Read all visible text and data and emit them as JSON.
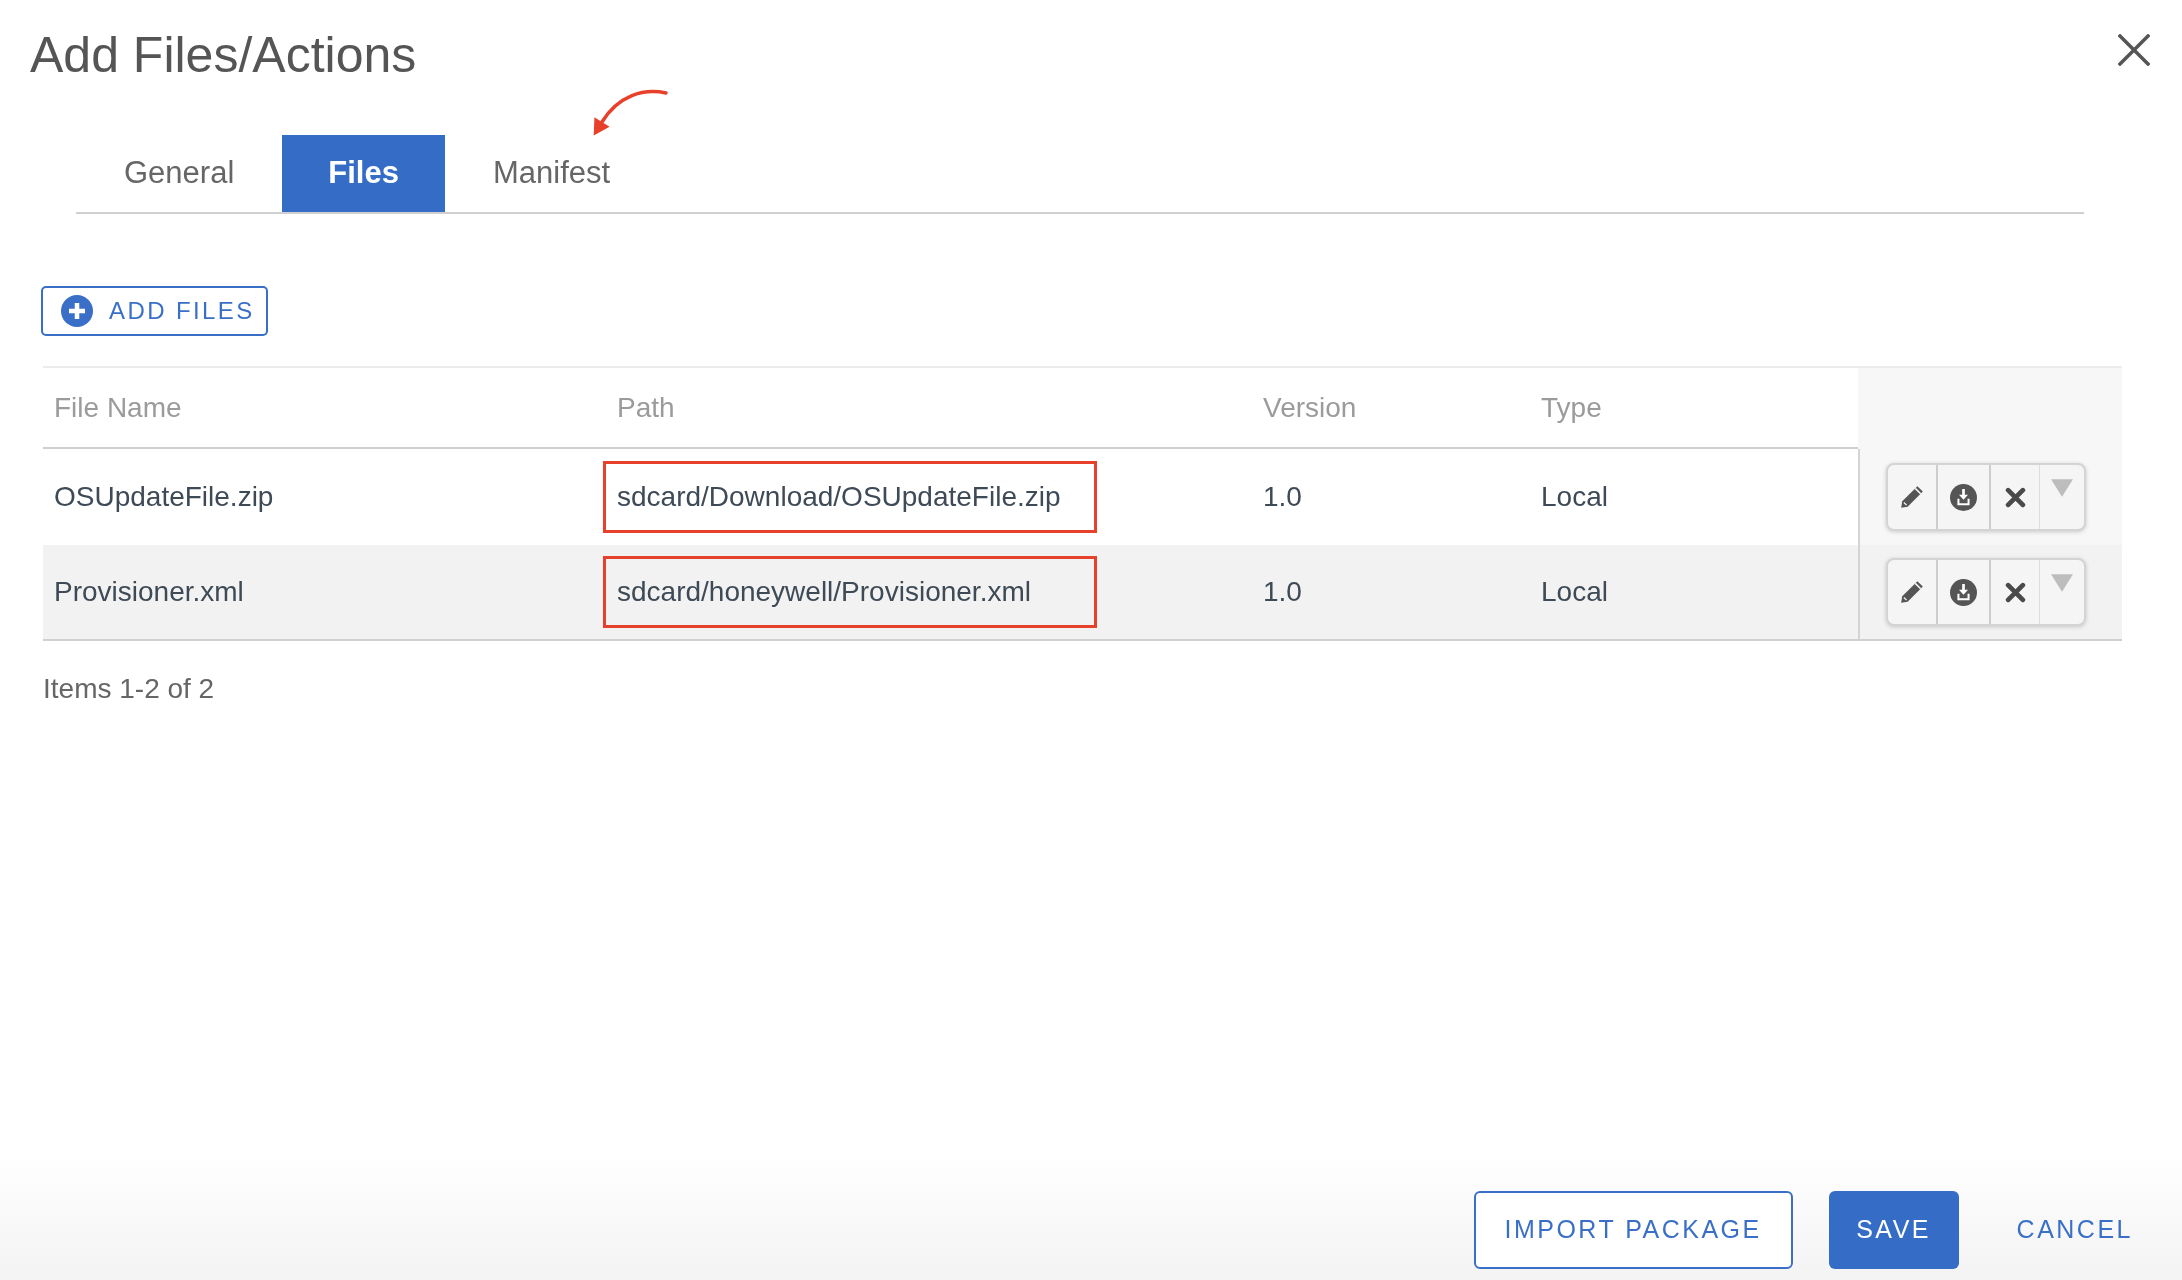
{
  "dialog": {
    "title": "Add Files/Actions"
  },
  "tabs": [
    {
      "label": "General",
      "selected": false
    },
    {
      "label": "Files",
      "selected": true
    },
    {
      "label": "Manifest",
      "selected": false
    }
  ],
  "add_files_button": {
    "label": "ADD FILES"
  },
  "table": {
    "columns": [
      "File Name",
      "Path",
      "Version",
      "Type"
    ],
    "rows": [
      {
        "file_name": "OSUpdateFile.zip",
        "path": "sdcard/Download/OSUpdateFile.zip",
        "version": "1.0",
        "type": "Local",
        "path_highlighted": true
      },
      {
        "file_name": "Provisioner.xml",
        "path": "sdcard/honeywell/Provisioner.xml",
        "version": "1.0",
        "type": "Local",
        "path_highlighted": true
      }
    ]
  },
  "pager": {
    "summary": "Items 1-2 of 2"
  },
  "footer_buttons": [
    {
      "label": "IMPORT PACKAGE",
      "kind": "outline"
    },
    {
      "label": "SAVE",
      "kind": "primary"
    },
    {
      "label": "CANCEL",
      "kind": "text"
    }
  ]
}
